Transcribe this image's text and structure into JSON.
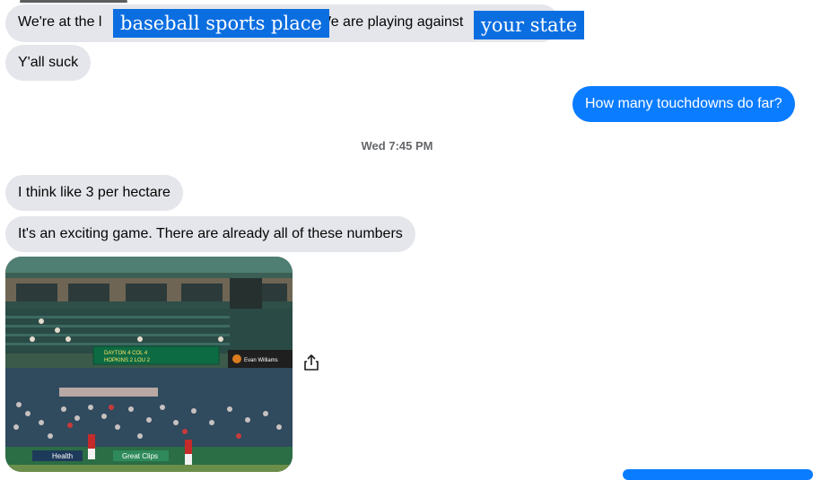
{
  "messages": {
    "m1": {
      "prefix": "We're at the l",
      "redact1": "baseball sports place",
      "middle": ". We are playing against",
      "redact2": "your state"
    },
    "m2": "Y'all suck",
    "m3": "How many touchdowns do far?",
    "timestamp": "Wed 7:45 PM",
    "m4": "I think like 3 per hectare",
    "m5": "It's an exciting game. There are already all of these numbers"
  },
  "photo": {
    "scoreboard": {
      "row1": "DAYTON   4   COL 4",
      "row2": "HOPKINS   2   LOU 2"
    },
    "sponsor": "Evan Williams",
    "ads": [
      "Health",
      "Great Clips"
    ]
  },
  "icons": {
    "share": "share-icon"
  },
  "colors": {
    "outgoing_bubble": "#0a7cff",
    "incoming_bubble": "#e4e6eb",
    "redaction": "#0b6ee0"
  }
}
